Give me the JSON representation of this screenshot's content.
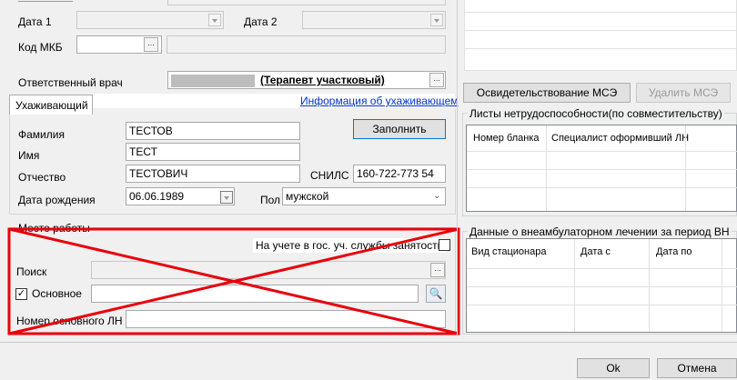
{
  "top": {
    "date1_label": "Дата 1",
    "date2_label": "Дата 2",
    "mkb_label": "Код МКБ",
    "ellipsis": "..."
  },
  "doctor": {
    "label": "Ответственный врач",
    "value": "(Терапевт участковый)"
  },
  "caregiver": {
    "tab_label": "Ухаживающий",
    "info_link": "Информация об ухаживающем",
    "surname_label": "Фамилия",
    "surname_value": "ТЕСТОВ",
    "name_label": "Имя",
    "name_value": "ТЕСТ",
    "patronymic_label": "Отчество",
    "patronymic_value": "ТЕСТОВИЧ",
    "birth_label": "Дата рождения",
    "birth_value": "06.06.1989",
    "fill_button": "Заполнить",
    "snils_label": "СНИЛС",
    "snils_value": "160-722-773 54",
    "sex_label": "Пол",
    "sex_value": "мужской"
  },
  "workplace": {
    "group_label": "Место работы",
    "employment_label": "На учете в гос. уч. службы занятости",
    "search_label": "Поиск",
    "main_label": "Основное",
    "main_ln_label": "Номер основного ЛН",
    "ellipsis": "..."
  },
  "mse": {
    "exam_button": "Освидетельствование МСЭ",
    "delete_button": "Удалить МСЭ"
  },
  "sick_leave": {
    "group_label": "Листы нетрудоспособности(по совместительству)",
    "columns": [
      "Номер бланка",
      "Специалист оформивший ЛН"
    ]
  },
  "inpatient": {
    "group_label": "Данные о внеамбулаторном лечении за период ВН",
    "columns": [
      "Вид стационара",
      "Дата с",
      "Дата по"
    ]
  },
  "footer": {
    "ok": "Ok",
    "cancel": "Отмена"
  },
  "colors": {
    "red_mark": "#e8000b",
    "link": "#0033cc"
  }
}
